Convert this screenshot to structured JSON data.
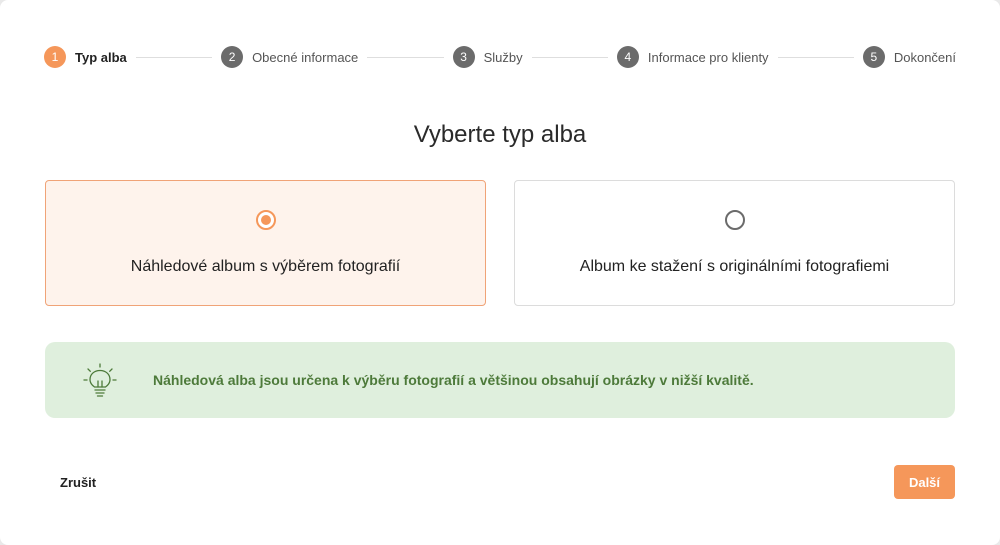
{
  "stepper": {
    "steps": [
      {
        "number": "1",
        "label": "Typ alba",
        "active": true
      },
      {
        "number": "2",
        "label": "Obecné informace",
        "active": false
      },
      {
        "number": "3",
        "label": "Služby",
        "active": false
      },
      {
        "number": "4",
        "label": "Informace pro klienty",
        "active": false
      },
      {
        "number": "5",
        "label": "Dokončení",
        "active": false
      }
    ]
  },
  "main": {
    "title": "Vyberte typ alba",
    "options": [
      {
        "label": "Náhledové album s výběrem fotografií",
        "selected": true
      },
      {
        "label": "Album ke stažení s originálními fotografiemi",
        "selected": false
      }
    ]
  },
  "info": {
    "icon": "lightbulb-icon",
    "text": "Náhledová alba jsou určena k výběru fotografií a většinou obsahují obrázky v nižší kvalitě."
  },
  "footer": {
    "cancel_label": "Zrušit",
    "next_label": "Další"
  },
  "colors": {
    "accent": "#f5975a",
    "selected_bg": "#fef3ec",
    "info_bg": "#dfefdd",
    "info_text": "#4d7a3a",
    "inactive_step": "#6b6b6b"
  }
}
